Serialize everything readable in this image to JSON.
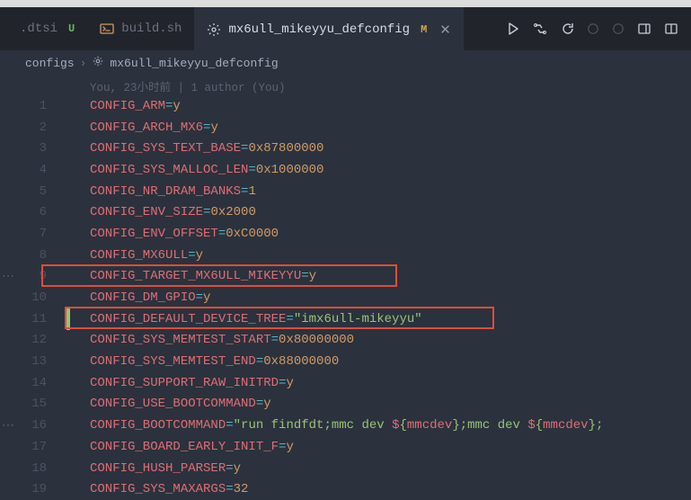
{
  "tabs": {
    "items": [
      {
        "label": ".dtsi",
        "status": "U",
        "icon": ""
      },
      {
        "label": "build.sh",
        "status": "",
        "icon": "terminal"
      },
      {
        "label": "mx6ull_mikeyyu_defconfig",
        "status": "M",
        "icon": "gear",
        "active": true
      }
    ]
  },
  "breadcrumb": {
    "seg1": "configs",
    "seg2": "mx6ull_mikeyyu_defconfig"
  },
  "blame": "You, 23小时前 | 1 author (You)",
  "lines": [
    {
      "n": "1",
      "key": "CONFIG_ARM",
      "val": "y",
      "type": "val"
    },
    {
      "n": "2",
      "key": "CONFIG_ARCH_MX6",
      "val": "y",
      "type": "val"
    },
    {
      "n": "3",
      "key": "CONFIG_SYS_TEXT_BASE",
      "val": "0x87800000",
      "type": "val"
    },
    {
      "n": "4",
      "key": "CONFIG_SYS_MALLOC_LEN",
      "val": "0x1000000",
      "type": "val"
    },
    {
      "n": "5",
      "key": "CONFIG_NR_DRAM_BANKS",
      "val": "1",
      "type": "val"
    },
    {
      "n": "6",
      "key": "CONFIG_ENV_SIZE",
      "val": "0x2000",
      "type": "val"
    },
    {
      "n": "7",
      "key": "CONFIG_ENV_OFFSET",
      "val": "0xC0000",
      "type": "val"
    },
    {
      "n": "8",
      "key": "CONFIG_MX6ULL",
      "val": "y",
      "type": "val"
    },
    {
      "n": "9",
      "key": "CONFIG_TARGET_MX6ULL_MIKEYYU",
      "val": "y",
      "type": "val",
      "boxed": true,
      "dots": true
    },
    {
      "n": "10",
      "key": "CONFIG_DM_GPIO",
      "val": "y",
      "type": "val"
    },
    {
      "n": "11",
      "key": "CONFIG_DEFAULT_DEVICE_TREE",
      "val": "\"imx6ull-mikeyyu\"",
      "type": "str",
      "boxed": true,
      "marker": "#98c379"
    },
    {
      "n": "12",
      "key": "CONFIG_SYS_MEMTEST_START",
      "val": "0x80000000",
      "type": "val"
    },
    {
      "n": "13",
      "key": "CONFIG_SYS_MEMTEST_END",
      "val": "0x88000000",
      "type": "val"
    },
    {
      "n": "14",
      "key": "CONFIG_SUPPORT_RAW_INITRD",
      "val": "y",
      "type": "val"
    },
    {
      "n": "15",
      "key": "CONFIG_USE_BOOTCOMMAND",
      "val": "y",
      "type": "val"
    },
    {
      "n": "16",
      "key": "CONFIG_BOOTCOMMAND",
      "type": "bootcmd",
      "dots": true
    },
    {
      "n": "17",
      "key": "CONFIG_BOARD_EARLY_INIT_F",
      "val": "y",
      "type": "val"
    },
    {
      "n": "18",
      "key": "CONFIG_HUSH_PARSER",
      "val": "y",
      "type": "val"
    },
    {
      "n": "19",
      "key": "CONFIG_SYS_MAXARGS",
      "val": "32",
      "type": "val"
    }
  ],
  "bootcmd": {
    "q": "\"",
    "p1": "run findfdt;mmc dev ",
    "d1": "$",
    "b1": "{",
    "v1": "mmcdev",
    "b2": "}",
    "p2": ";mmc dev ",
    "d2": "$",
    "b3": "{",
    "v2": "mmcdev",
    "b4": "}",
    "tail": ";"
  }
}
